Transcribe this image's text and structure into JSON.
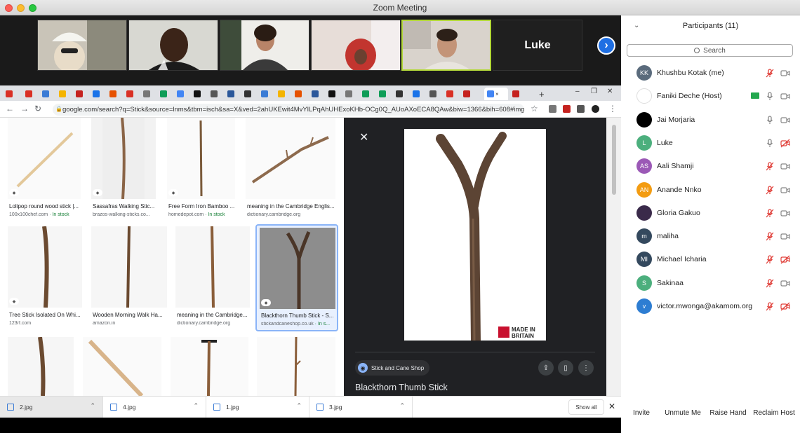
{
  "window": {
    "title": "Zoom Meeting"
  },
  "gallery": {
    "luke_label": "Luke"
  },
  "browser": {
    "url": "google.com/search?q=Stick&source=lnms&tbm=isch&sa=X&ved=2ahUKEwit4MvYlLPqAhUHExoKHb-OCg0Q_AUoAXoECA8QAw&biw=1366&bih=608#imgrc=B..."
  },
  "results": [
    {
      "caption": "Lolipop round wood stick |...",
      "source": "100x100chef.com",
      "stock": " · In stock"
    },
    {
      "caption": "Sassafras Walking Stic...",
      "source": "brazos-walking-sticks.co...",
      "stock": ""
    },
    {
      "caption": "Free Form Iron Bamboo ...",
      "source": "homedepot.com",
      "stock": " · In stock"
    },
    {
      "caption": "meaning in the Cambridge Englis...",
      "source": "dictionary.cambridge.org",
      "stock": ""
    },
    {
      "caption": "Tree Stick Isolated On Whi...",
      "source": "123rf.com",
      "stock": ""
    },
    {
      "caption": "Wooden Morning Walk Ha...",
      "source": "amazon.in",
      "stock": ""
    },
    {
      "caption": "meaning in the Cambridge...",
      "source": "dictionary.cambridge.org",
      "stock": ""
    },
    {
      "caption": "Blackthorn Thumb Stick - S...",
      "source": "stickandcaneshop.co.uk",
      "stock": " · In s..."
    }
  ],
  "preview": {
    "site": "Stick and Cane Shop",
    "title": "Blackthorn Thumb Stick",
    "badge_line1": "MADE IN",
    "badge_line2": "BRITAIN"
  },
  "downloads": {
    "items": [
      "2.jpg",
      "4.jpg",
      "1.jpg",
      "3.jpg"
    ],
    "show_all": "Show all"
  },
  "participants": {
    "header": "Participants (11)",
    "search_placeholder": "Search",
    "list": [
      {
        "initials": "KK",
        "name": "Khushbu Kotak (me)",
        "color": "#5a6b7c",
        "mic": "muted",
        "cam": "on"
      },
      {
        "initials": "",
        "name": "Faniki Deche (Host)",
        "color": "#ffffff",
        "mic": "on",
        "cam": "on",
        "share": true
      },
      {
        "initials": "",
        "name": "Jai Morjaria",
        "color": "#000000",
        "mic": "on",
        "cam": "on"
      },
      {
        "initials": "L",
        "name": "Luke",
        "color": "#4caf7d",
        "mic": "on",
        "cam": "off"
      },
      {
        "initials": "AS",
        "name": "Aali Shamji",
        "color": "#9b59b6",
        "mic": "muted",
        "cam": "on"
      },
      {
        "initials": "AN",
        "name": "Anande Nnko",
        "color": "#f39c12",
        "mic": "muted",
        "cam": "on"
      },
      {
        "initials": "",
        "name": "Gloria Gakuo",
        "color": "#3a2a4a",
        "mic": "muted",
        "cam": "on"
      },
      {
        "initials": "m",
        "name": "maliha",
        "color": "#34495e",
        "mic": "muted",
        "cam": "on"
      },
      {
        "initials": "MI",
        "name": "Michael Icharia",
        "color": "#34495e",
        "mic": "muted",
        "cam": "off"
      },
      {
        "initials": "S",
        "name": "Sakinaa",
        "color": "#4caf7d",
        "mic": "muted",
        "cam": "on"
      },
      {
        "initials": "v",
        "name": "victor.mwonga@akamom.org",
        "color": "#2d7dd2",
        "mic": "muted",
        "cam": "off"
      }
    ],
    "buttons": [
      "Invite",
      "Unmute Me",
      "Raise Hand",
      "Reclaim Host"
    ]
  }
}
